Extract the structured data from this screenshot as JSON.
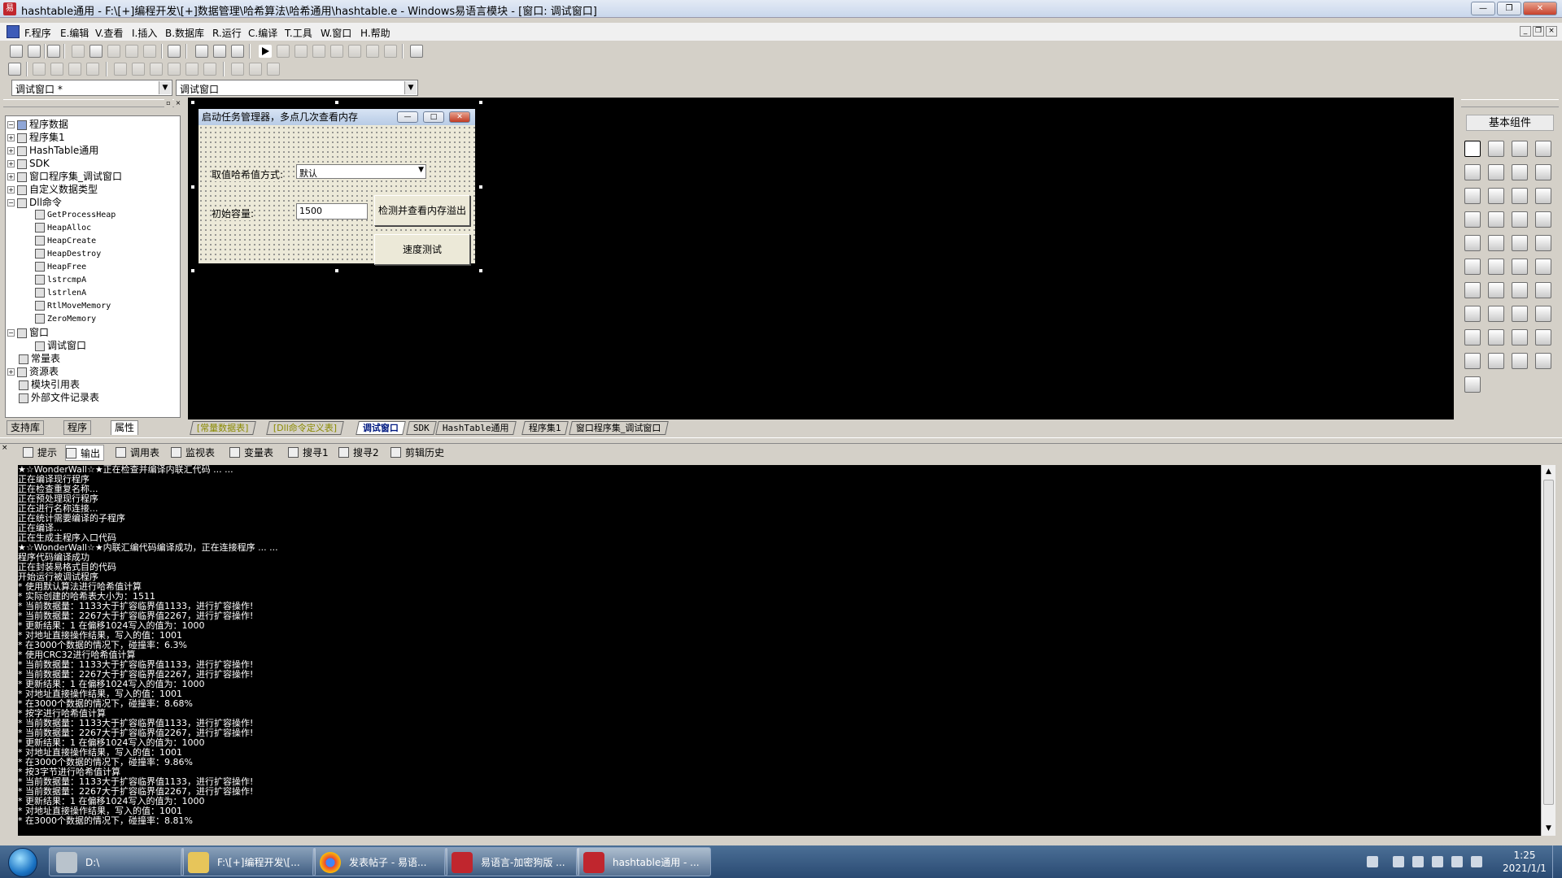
{
  "window": {
    "title": "hashtable通用 - F:\\[+]编程开发\\[+]数据管理\\哈希算法\\哈希通用\\hashtable.e - Windows易语言模块 - [窗口: 调试窗口]"
  },
  "menu": [
    "F.程序",
    "E.编辑",
    "V.查看",
    "I.插入",
    "B.数据库",
    "R.运行",
    "C.编译",
    "T.工具",
    "W.窗口",
    "H.帮助"
  ],
  "combos": {
    "left": "调试窗口 *",
    "right": "调试窗口"
  },
  "tree": {
    "root": "程序数据",
    "items": [
      "程序集1",
      "HashTable通用",
      "SDK",
      "窗口程序集_调试窗口",
      "自定义数据类型",
      "Dll命令"
    ],
    "dll": [
      "GetProcessHeap",
      "HeapAlloc",
      "HeapCreate",
      "HeapDestroy",
      "HeapFree",
      "lstrcmpA",
      "lstrlenA",
      "RtlMoveMemory",
      "ZeroMemory"
    ],
    "windows_label": "窗口",
    "window_child": "调试窗口",
    "tail": [
      "常量表",
      "资源表",
      "模块引用表",
      "外部文件记录表"
    ]
  },
  "left_tabs": [
    "支持库",
    "程序",
    "属性"
  ],
  "form": {
    "title": "启动任务管理器，多点几次查看内存",
    "hash_label": "取值哈希值方式:",
    "hash_value": "默认",
    "cap_label": "初始容量:",
    "cap_value": "1500",
    "btn_check": "检测并查看内存溢出",
    "btn_speed": "速度测试"
  },
  "design_tabs": [
    "[常量数据表]",
    "[Dll命令定义表]",
    "调试窗口",
    "SDK",
    "HashTable通用",
    "程序集1",
    "窗口程序集_调试窗口"
  ],
  "components_title": "基本组件",
  "output_tabs": [
    "提示",
    "输出",
    "调用表",
    "监视表",
    "变量表",
    "搜寻1",
    "搜寻2",
    "剪辑历史"
  ],
  "console": [
    "★☆WonderWall☆★正在检查并编译内联汇代码 ... ...",
    "正在编译现行程序",
    "正在检查重复名称...",
    "正在预处理现行程序",
    "正在进行名称连接...",
    "正在统计需要编译的子程序",
    "正在编译...",
    "正在生成主程序入口代码",
    "★☆WonderWall☆★内联汇编代码编译成功，正在连接程序 ... ...",
    "程序代码编译成功",
    "正在封装易格式目的代码",
    "开始运行被调试程序",
    "* 使用默认算法进行哈希值计算",
    "* 实际创建的哈希表大小为：1511",
    "* 当前数据量：1133大于扩容临界值1133，进行扩容操作!",
    "* 当前数据量：2267大于扩容临界值2267，进行扩容操作!",
    "* 更新结果：1 在偏移1024写入的值为：1000",
    "* 对地址直接操作结果，写入的值：1001",
    "* 在3000个数据的情况下，碰撞率：6.3%",
    "* 使用CRC32进行哈希值计算",
    "* 当前数据量：1133大于扩容临界值1133，进行扩容操作!",
    "* 当前数据量：2267大于扩容临界值2267，进行扩容操作!",
    "* 更新结果：1 在偏移1024写入的值为：1000",
    "* 对地址直接操作结果，写入的值：1001",
    "* 在3000个数据的情况下，碰撞率：8.68%",
    "* 按字进行哈希值计算",
    "* 当前数据量：1133大于扩容临界值1133，进行扩容操作!",
    "* 当前数据量：2267大于扩容临界值2267，进行扩容操作!",
    "* 更新结果：1 在偏移1024写入的值为：1000",
    "* 对地址直接操作结果，写入的值：1001",
    "* 在3000个数据的情况下，碰撞率：9.86%",
    "* 按3字节进行哈希值计算",
    "* 当前数据量：1133大于扩容临界值1133，进行扩容操作!",
    "* 当前数据量：2267大于扩容临界值2267，进行扩容操作!",
    "* 更新结果：1 在偏移1024写入的值为：1000",
    "* 对地址直接操作结果，写入的值：1001",
    "* 在3000个数据的情况下，碰撞率：8.81%"
  ],
  "taskbar": {
    "tasks": [
      "D:\\",
      "F:\\[+]编程开发\\[...",
      "发表帖子 - 易语...",
      "易语言-加密狗版 ...",
      "hashtable通用 - ..."
    ],
    "time": "1:25",
    "date": "2021/1/1"
  },
  "colors": {
    "designer_bg": "#000000",
    "console_bg": "#000000",
    "console_text": "#ffffff",
    "taskbar": "#2a4a72"
  }
}
